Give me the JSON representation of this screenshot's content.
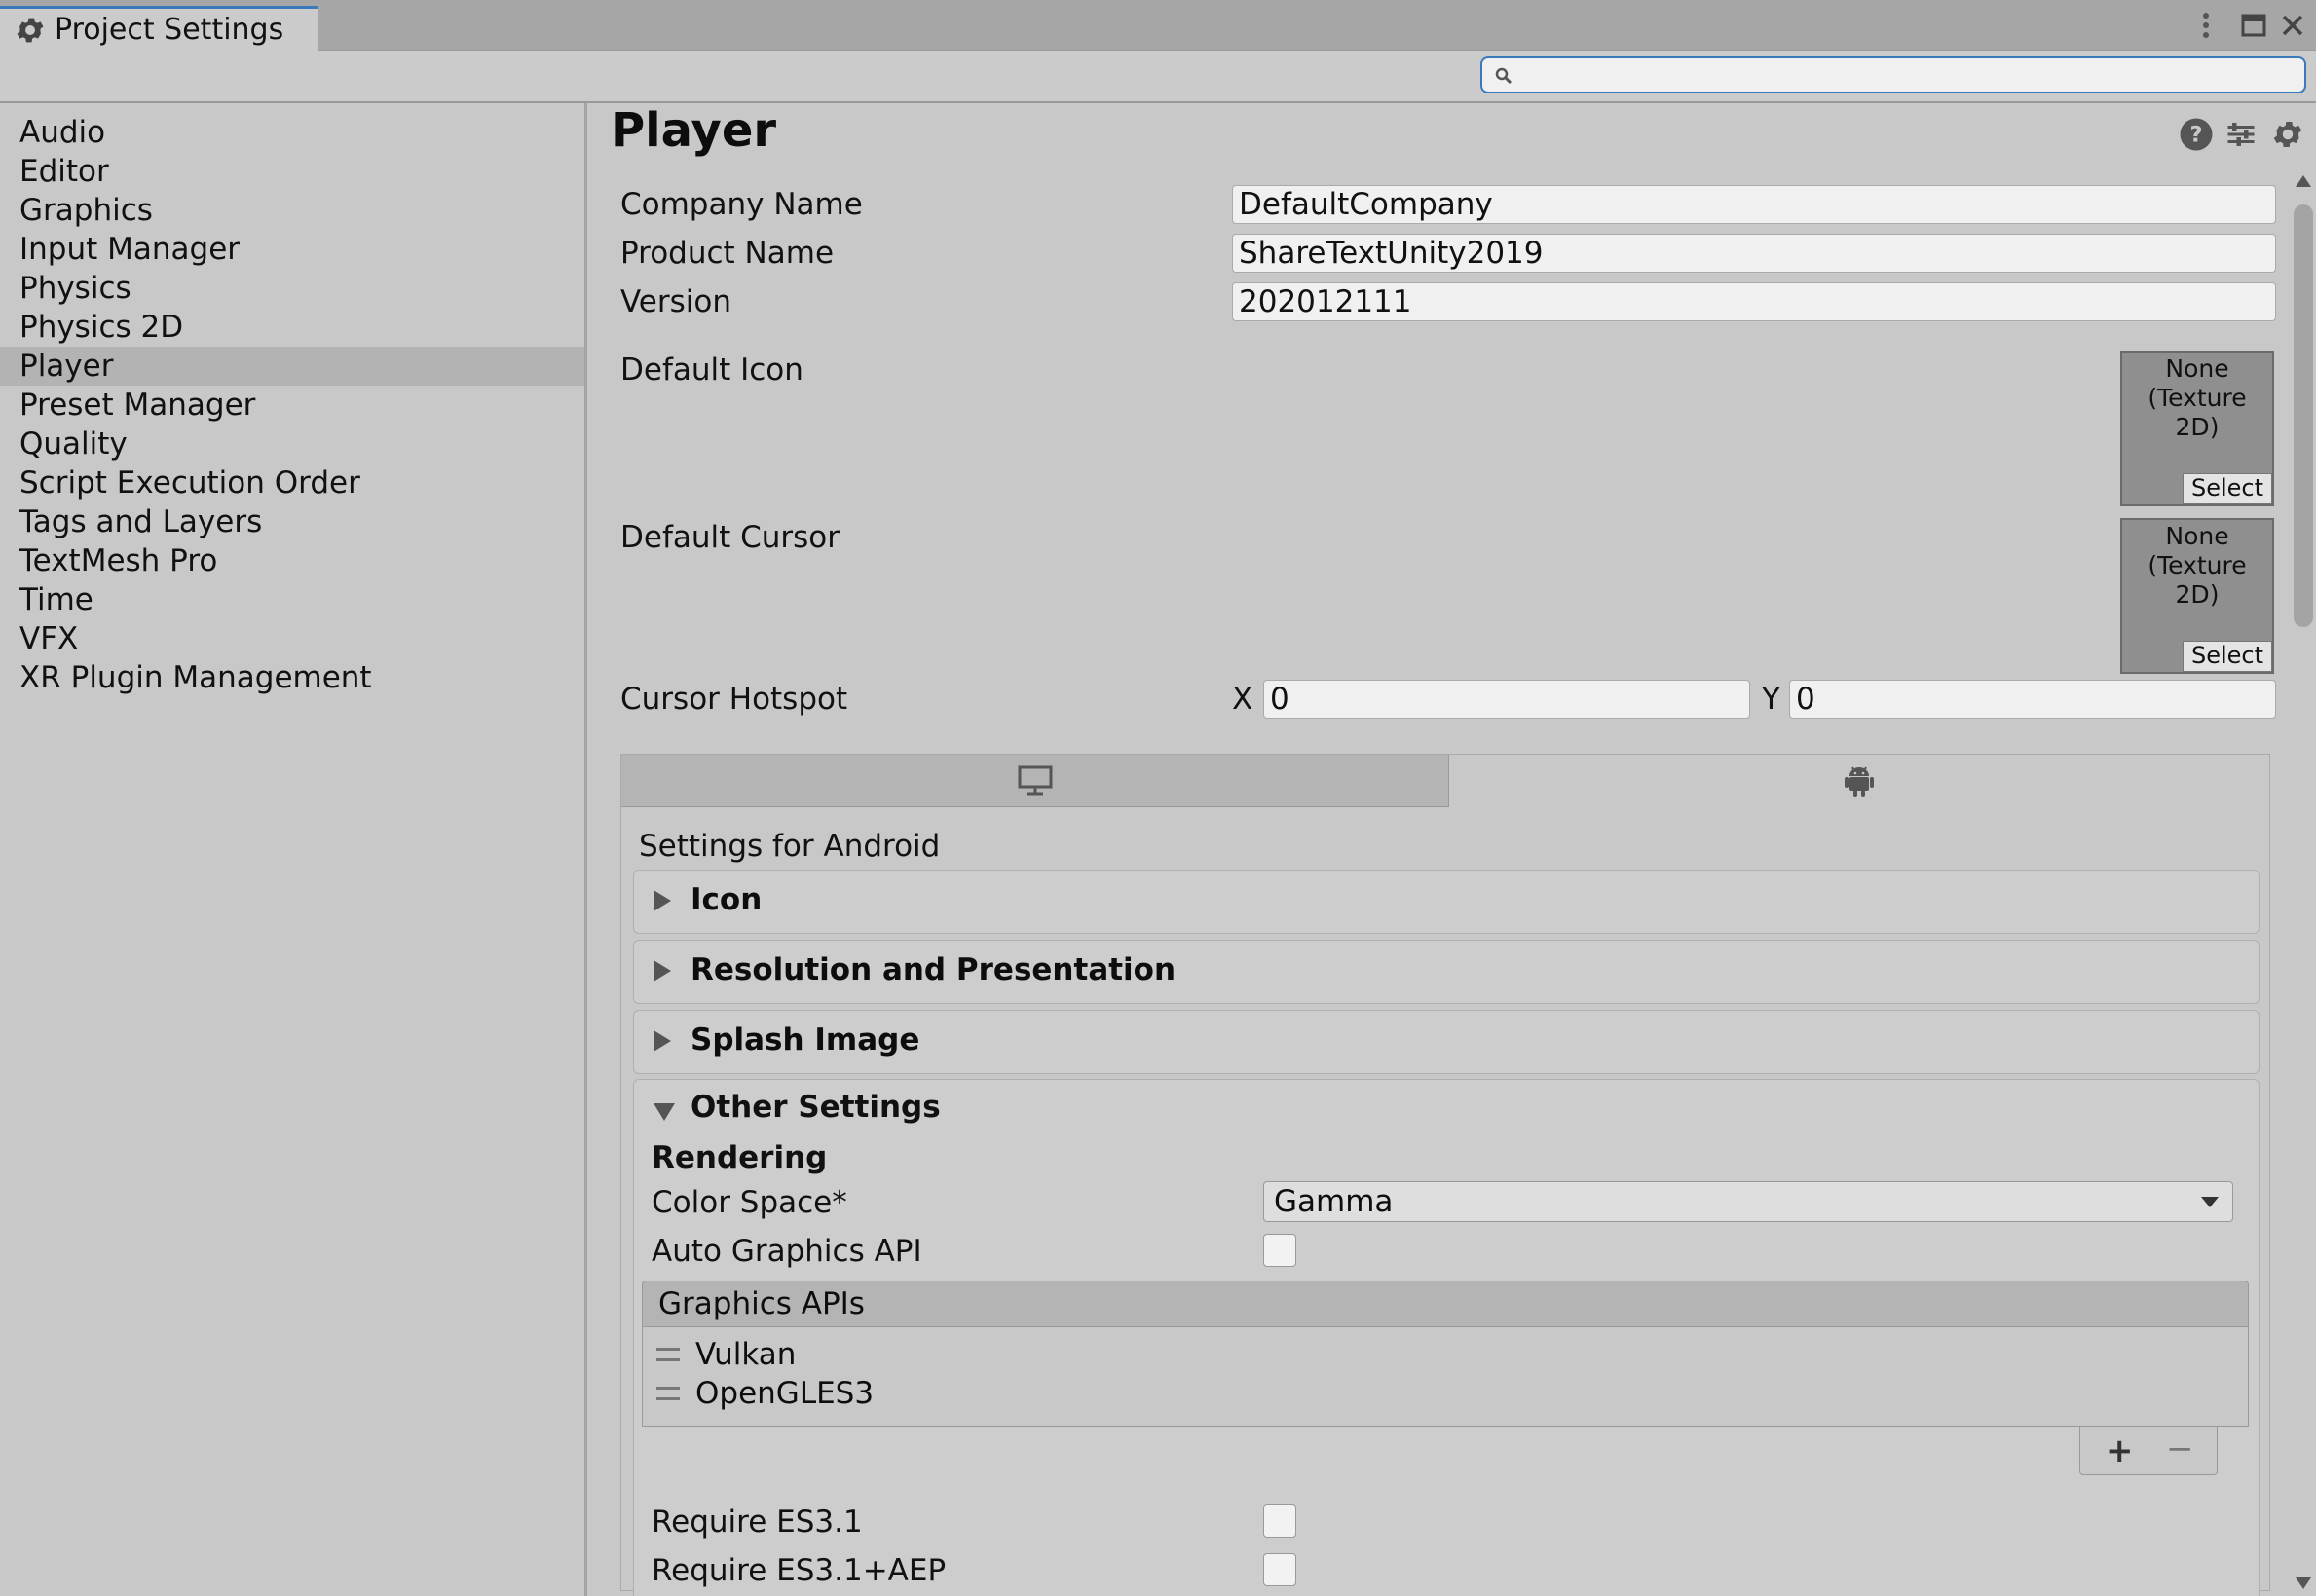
{
  "window": {
    "tab_title": "Project Settings",
    "tab_icon": "gear-icon",
    "controls": [
      "more-vert-icon",
      "maximize-icon",
      "close-icon"
    ]
  },
  "search": {
    "placeholder": "",
    "value": ""
  },
  "sidebar": {
    "selected": "Player",
    "items": [
      {
        "label": "Audio"
      },
      {
        "label": "Editor"
      },
      {
        "label": "Graphics"
      },
      {
        "label": "Input Manager"
      },
      {
        "label": "Physics"
      },
      {
        "label": "Physics 2D"
      },
      {
        "label": "Player"
      },
      {
        "label": "Preset Manager"
      },
      {
        "label": "Quality"
      },
      {
        "label": "Script Execution Order"
      },
      {
        "label": "Tags and Layers"
      },
      {
        "label": "TextMesh Pro"
      },
      {
        "label": "Time"
      },
      {
        "label": "VFX"
      },
      {
        "label": "XR Plugin Management"
      }
    ]
  },
  "main": {
    "title": "Player",
    "header_icons": [
      "help-icon",
      "preset-icon",
      "settings-gear-icon"
    ],
    "company_name": {
      "label": "Company Name",
      "value": "DefaultCompany"
    },
    "product_name": {
      "label": "Product Name",
      "value": "ShareTextUnity2019"
    },
    "version": {
      "label": "Version",
      "value": "202012111"
    },
    "default_icon": {
      "label": "Default Icon",
      "slot_line1": "None",
      "slot_line2": "(Texture 2D)",
      "select": "Select"
    },
    "default_cursor": {
      "label": "Default Cursor",
      "slot_line1": "None",
      "slot_line2": "(Texture 2D)",
      "select": "Select"
    },
    "cursor_hotspot": {
      "label": "Cursor Hotspot",
      "x_label": "X",
      "x_value": "0",
      "y_label": "Y",
      "y_value": "0"
    },
    "platform_tabs": [
      "monitor-icon",
      "android-icon"
    ],
    "settings_for": "Settings for Android",
    "sections": [
      {
        "title": "Icon"
      },
      {
        "title": "Resolution and Presentation"
      },
      {
        "title": "Splash Image"
      }
    ],
    "other_settings": {
      "title": "Other Settings",
      "rendering": "Rendering",
      "color_space": {
        "label": "Color Space*",
        "value": "Gamma"
      },
      "auto_graphics_api": {
        "label": "Auto Graphics API",
        "checked": false
      },
      "graphics_apis": {
        "header": "Graphics APIs",
        "items": [
          "Vulkan",
          "OpenGLES3"
        ],
        "add": "+",
        "remove": "−"
      },
      "require_es31": {
        "label": "Require ES3.1",
        "checked": false
      },
      "require_es31_aep": {
        "label": "Require ES3.1+AEP",
        "checked": false
      }
    }
  },
  "colors": {
    "accent": "#3a79bb",
    "selected_row": "#b3b3b3",
    "background": "#c8c8c8"
  }
}
